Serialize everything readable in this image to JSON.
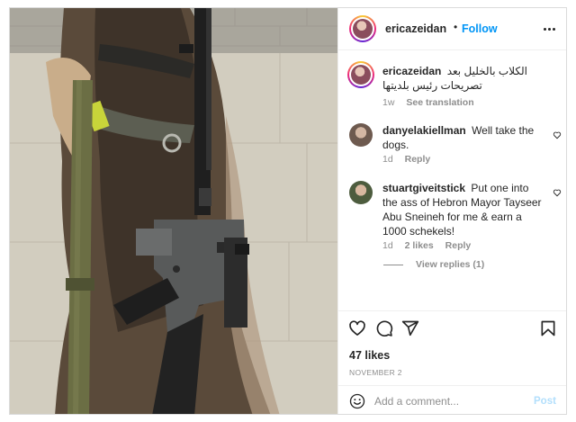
{
  "post": {
    "author": "ericazeidan",
    "separator": "•",
    "follow_label": "Follow",
    "more_icon": "more-horizontal-icon"
  },
  "caption": {
    "author": "ericazeidan",
    "text": "الكلاب بالخليل بعد تصريحات رئيس بلديتها",
    "age": "1w",
    "see_translation": "See translation"
  },
  "comments": [
    {
      "author": "danyelakiellman",
      "text": "Well take the dogs.",
      "age": "1d",
      "reply_label": "Reply"
    },
    {
      "author": "stuartgiveitstick",
      "text": "Put one into the ass of Hebron Mayor Tayseer Abu Sneineh for me & earn a 1000 schekels!",
      "age": "1d",
      "likes_label": "2 likes",
      "reply_label": "Reply"
    }
  ],
  "view_replies": "View replies (1)",
  "stats": {
    "likes": "47 likes",
    "date": "NOVEMBER 2"
  },
  "composer": {
    "placeholder": "Add a comment...",
    "post_label": "Post"
  },
  "colors": {
    "accent": "#0095f6",
    "post_disabled": "#b2dffc",
    "muted": "#8e8e8e",
    "text": "#262626"
  }
}
